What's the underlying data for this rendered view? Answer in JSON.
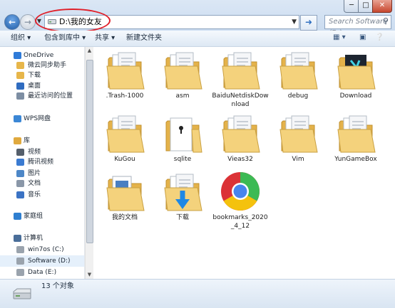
{
  "window": {
    "minimize_label": "─",
    "maximize_label": "□",
    "close_label": "✕"
  },
  "address_bar": {
    "path": "D:\\我的女友",
    "search_placeholder": "Search Software (D:)",
    "search_icon": "magnifier-icon",
    "go_icon": "arrow-right-icon"
  },
  "toolbar": {
    "organize": "组织 ▾",
    "include_library": "包含到库中 ▾",
    "share": "共享 ▾",
    "new_folder": "新建文件夹"
  },
  "nav": {
    "items": [
      {
        "label": "OneDrive",
        "icon": "cloud-icon",
        "color": "#2f7bd8"
      },
      {
        "label": "微云同步助手",
        "icon": "folder-icon",
        "color": "#e7b64a"
      },
      {
        "label": "下载",
        "icon": "download-folder-icon",
        "color": "#e7b64a"
      },
      {
        "label": "桌面",
        "icon": "desktop-icon",
        "color": "#2f6cc0"
      },
      {
        "label": "最近访问的位置",
        "icon": "recent-places-icon",
        "color": "#7d8ea3"
      },
      {
        "label": "WPS网盘",
        "icon": "cloud-icon",
        "color": "#3b87d5"
      },
      {
        "label": "库",
        "icon": "library-icon",
        "color": "#e0a93e"
      },
      {
        "label": "视频",
        "icon": "video-library-icon",
        "color": "#555f6b"
      },
      {
        "label": "腾讯视频",
        "icon": "tencent-video-icon",
        "color": "#3b7bd1"
      },
      {
        "label": "图片",
        "icon": "pictures-library-icon",
        "color": "#4d87c7"
      },
      {
        "label": "文档",
        "icon": "documents-library-icon",
        "color": "#8a97a8"
      },
      {
        "label": "音乐",
        "icon": "music-library-icon",
        "color": "#3b73c4"
      },
      {
        "label": "家庭组",
        "icon": "homegroup-icon",
        "color": "#2f7fd0"
      },
      {
        "label": "计算机",
        "icon": "computer-icon",
        "color": "#4a6e99"
      },
      {
        "label": "win7os (C:)",
        "icon": "drive-icon",
        "color": "#9aa3ad"
      },
      {
        "label": "Software (D:)",
        "icon": "drive-icon",
        "color": "#9aa3ad"
      },
      {
        "label": "Data (E:)",
        "icon": "drive-icon",
        "color": "#9aa3ad"
      }
    ]
  },
  "files": [
    {
      "name": ".Trash-1000",
      "type": "folder"
    },
    {
      "name": "asm",
      "type": "folder"
    },
    {
      "name": "BaiduNetdiskDownload",
      "type": "folder"
    },
    {
      "name": "debug",
      "type": "folder"
    },
    {
      "name": "Download",
      "type": "folder-dark"
    },
    {
      "name": "KuGou",
      "type": "folder"
    },
    {
      "name": "sqlite",
      "type": "folder-keyhole"
    },
    {
      "name": "Vieas32",
      "type": "folder"
    },
    {
      "name": "Vim",
      "type": "folder"
    },
    {
      "name": "YunGameBox",
      "type": "folder"
    },
    {
      "name": "我的文档",
      "type": "folder-docs"
    },
    {
      "name": "下载",
      "type": "folder-download"
    },
    {
      "name": "bookmarks_2020_4_12",
      "type": "chrome"
    }
  ],
  "status": {
    "count_text": "13 个对象"
  }
}
